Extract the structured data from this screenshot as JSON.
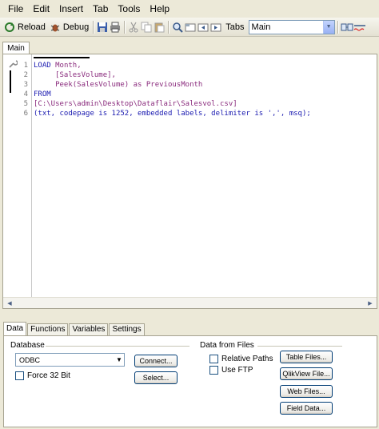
{
  "menu": [
    "File",
    "Edit",
    "Insert",
    "Tab",
    "Tools",
    "Help"
  ],
  "toolbar": {
    "reload_label": "Reload",
    "debug_label": "Debug",
    "tabs_label": "Tabs",
    "tab_select_value": "Main"
  },
  "editor": {
    "tab_label": "Main",
    "line_numbers": [
      "1",
      "2",
      "3",
      "4",
      "5",
      "6"
    ]
  },
  "bottom": {
    "tabs": [
      "Data",
      "Functions",
      "Variables",
      "Settings"
    ],
    "database_label": "Database",
    "database_value": "ODBC",
    "connect_label": "Connect...",
    "select_label": "Select...",
    "force32_label": "Force 32 Bit",
    "data_from_files_label": "Data from Files",
    "relative_paths_label": "Relative Paths",
    "use_ftp_label": "Use FTP",
    "table_files_label": "Table Files...",
    "qlikview_file_label": "QlikView File...",
    "web_files_label": "Web Files...",
    "field_data_label": "Field Data..."
  },
  "colors": {
    "keyword": "#1a1ab0",
    "identifier": "#8a2b7d"
  }
}
